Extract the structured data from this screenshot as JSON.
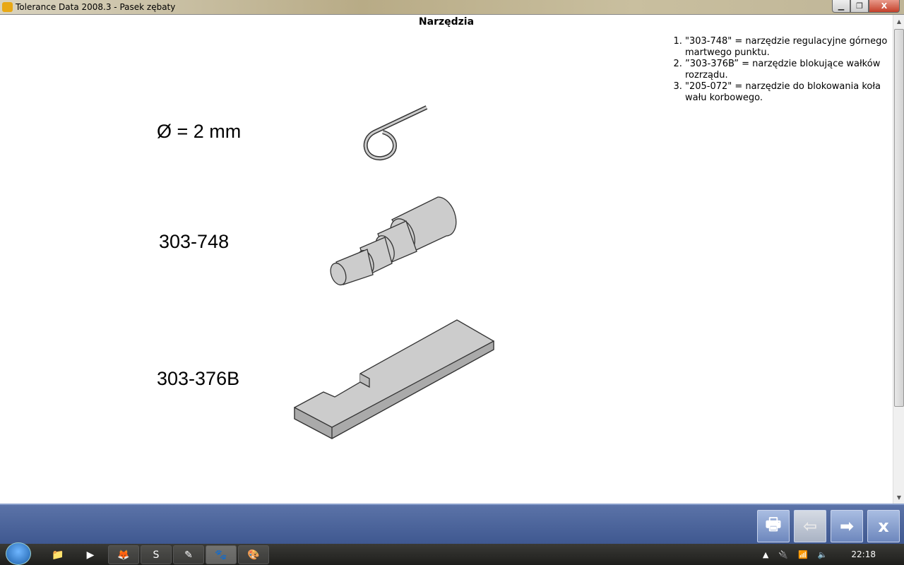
{
  "window": {
    "title": "Tolerance Data 2008.3 - Pasek zębaty",
    "minimize": "▁",
    "maximize": "❐",
    "close": "X"
  },
  "content": {
    "heading": "Narzędzia",
    "notes": [
      "\"303-748\" = narzędzie regulacyjne górnego martwego punktu.",
      "”303-376B” = narzędzie blokujące wałków rozrządu.",
      "\"205-072\" = narzędzie do blokowania koła wału korbowego."
    ],
    "labels": {
      "pin": "Ø = 2 mm",
      "tool1": "303-748",
      "tool2": "303-376B"
    }
  },
  "toolbar": {
    "print": "🖶",
    "back": "⇦",
    "forward": "➡",
    "close": "x"
  },
  "taskbar": {
    "clock": "22:18",
    "tray_arrow": "▲",
    "power": "🔌",
    "signal": "📶",
    "volume": "🔈"
  }
}
